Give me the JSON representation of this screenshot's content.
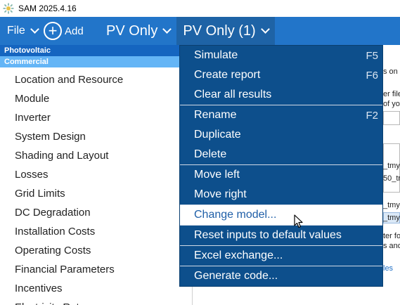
{
  "window": {
    "title": "SAM 2025.4.16"
  },
  "toolbar": {
    "file_label": "File",
    "add_label": "Add",
    "case_tab_1": "PV Only",
    "case_tab_2": "PV Only (1)"
  },
  "sidebar": {
    "header_tech": "Photovoltaic",
    "header_fin": "Commercial",
    "items": [
      {
        "label": "Location and Resource"
      },
      {
        "label": "Module"
      },
      {
        "label": "Inverter"
      },
      {
        "label": "System Design"
      },
      {
        "label": "Shading and Layout"
      },
      {
        "label": "Losses"
      },
      {
        "label": "Grid Limits"
      },
      {
        "label": "DC Degradation"
      },
      {
        "label": "Installation Costs"
      },
      {
        "label": "Operating Costs"
      },
      {
        "label": "Financial Parameters"
      },
      {
        "label": "Incentives"
      },
      {
        "label": "Electricity Rates"
      }
    ]
  },
  "background_fragments": {
    "frag1": "s on",
    "frag2": "er file",
    "frag3": "of yo",
    "frag4": "_tmy",
    "frag5": "50_tr",
    "frag6": "_tmy",
    "frag7": "_tmy",
    "frag8": "ter fo",
    "frag9": "s and",
    "frag10": "les"
  },
  "menu": {
    "items": [
      {
        "label": "Simulate",
        "shortcut": "F5"
      },
      {
        "label": "Create report",
        "shortcut": "F6"
      },
      {
        "label": "Clear all results",
        "shortcut": ""
      },
      {
        "label": "Rename",
        "shortcut": "F2"
      },
      {
        "label": "Duplicate",
        "shortcut": ""
      },
      {
        "label": "Delete",
        "shortcut": ""
      },
      {
        "label": "Move left",
        "shortcut": ""
      },
      {
        "label": "Move right",
        "shortcut": ""
      },
      {
        "label": "Change model...",
        "shortcut": ""
      },
      {
        "label": "Reset inputs to default values",
        "shortcut": ""
      },
      {
        "label": "Excel exchange...",
        "shortcut": ""
      },
      {
        "label": "Generate code...",
        "shortcut": ""
      }
    ]
  },
  "colors": {
    "toolbar": "#2275c9",
    "menu_bg": "#0d4f8c",
    "header_pv": "#1565c0",
    "header_commercial": "#64b5f6",
    "hover_text": "#1f5fa8"
  },
  "icons": {
    "app": "sam-logo-icon",
    "add": "plus-circle-icon",
    "chevron": "chevron-down-icon",
    "cursor": "mouse-pointer-icon"
  }
}
